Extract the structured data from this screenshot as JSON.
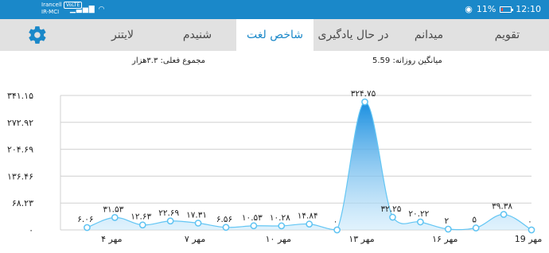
{
  "status_bar": {
    "carrier_1": "Irancell",
    "lte_badge": "VoLTE",
    "carrier_2": "IR-MCI",
    "battery_percent": "11%",
    "time": "12:10"
  },
  "tabs": [
    {
      "label": "تقویم"
    },
    {
      "label": "میدانم"
    },
    {
      "label": "در حال یادگیری"
    },
    {
      "label": "شاخص لغت"
    },
    {
      "label": "شنیدم"
    },
    {
      "label": "لایتنر"
    }
  ],
  "summary": {
    "daily_average": "میانگین روزانه: 5.59",
    "actual_total": "مجموع فعلی: ۳.۳هزار"
  },
  "colors": {
    "primary": "#1a88c9",
    "tab_bar": "#e1e1e1",
    "fill": "#29a8ec"
  },
  "chart_data": {
    "type": "area",
    "ylim": [
      0,
      341.15
    ],
    "y_ticks": [
      "۰",
      "۶۸.۲۳",
      "۱۳۶.۴۶",
      "۲۰۴.۶۹",
      "۲۷۲.۹۲",
      "۳۴۱.۱۵"
    ],
    "x": [
      3,
      4,
      5,
      6,
      7,
      8,
      9,
      10,
      11,
      12,
      13,
      14,
      15,
      16,
      17,
      18,
      19
    ],
    "x_labels": [
      {
        "x": 4,
        "label": "۴ مهر"
      },
      {
        "x": 7,
        "label": "۷ مهر"
      },
      {
        "x": 10,
        "label": "۱۰ مهر"
      },
      {
        "x": 13,
        "label": "۱۳ مهر"
      },
      {
        "x": 16,
        "label": "۱۶ مهر"
      },
      {
        "x": 19,
        "label": "19 مهر"
      }
    ],
    "series": [
      {
        "values": [
          6.06,
          31.53,
          12.63,
          22.69,
          17.31,
          6.56,
          10.53,
          10.28,
          14.84,
          0,
          324.75,
          32.25,
          20.22,
          2,
          5,
          39.38,
          0
        ],
        "labels": [
          "۶.۰۶",
          "۳۱.۵۳",
          "۱۲.۶۳",
          "۲۲.۶۹",
          "۱۷.۳۱",
          "۶.۵۶",
          "۱۰.۵۳",
          "۱۰.۲۸",
          "۱۴.۸۴",
          "۰",
          "۳۲۴.۷۵",
          "۳۲.۲۵",
          "۲۰.۲۲",
          "۲",
          "۵",
          "۳۹.۳۸",
          "۰"
        ]
      }
    ]
  }
}
